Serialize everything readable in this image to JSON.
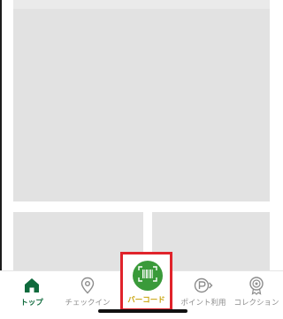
{
  "tabbar": {
    "items": [
      {
        "label": "トップ",
        "icon": "home-icon",
        "active": true
      },
      {
        "label": "チェックイン",
        "icon": "map-pin-icon",
        "active": false
      },
      {
        "label": "バーコード",
        "icon": "barcode-icon",
        "active": false,
        "highlighted": true
      },
      {
        "label": "ポイント利用",
        "icon": "point-icon",
        "active": false
      },
      {
        "label": "コレクション",
        "icon": "medal-icon",
        "active": false
      }
    ]
  },
  "colors": {
    "active_tab": "#0f6a3c",
    "barcode_button": "#3a9a3a",
    "barcode_label": "#c9a40d",
    "highlight_border": "#e0232b",
    "placeholder": "#e2e2e2"
  }
}
